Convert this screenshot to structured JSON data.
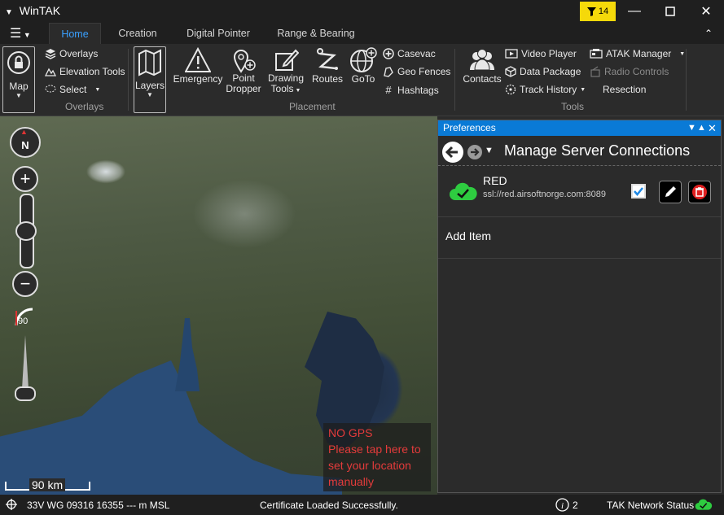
{
  "titlebar": {
    "app_title": "WinTAK",
    "filter_count": "14"
  },
  "tabs": [
    {
      "label": "Home"
    },
    {
      "label": "Creation"
    },
    {
      "label": "Digital Pointer"
    },
    {
      "label": "Range & Bearing"
    }
  ],
  "ribbon": {
    "map_label": "Map",
    "overlays_items": {
      "overlays": "Overlays",
      "elevation": "Elevation Tools",
      "select": "Select"
    },
    "overlays_group": "Overlays",
    "layers_label": "Layers",
    "emergency": "Emergency",
    "point_dropper": "Point\nDropper",
    "drawing_tools": "Drawing\nTools",
    "routes": "Routes",
    "goto": "GoTo",
    "casevac": "Casevac",
    "geo_fences": "Geo Fences",
    "hashtags": "Hashtags",
    "placement_group": "Placement",
    "contacts": "Contacts",
    "video_player": "Video Player",
    "data_package": "Data Package",
    "track_history": "Track History",
    "atak_manager": "ATAK Manager",
    "radio_controls": "Radio Controls",
    "resection": "Resection",
    "tools_group": "Tools"
  },
  "map": {
    "compass": "N",
    "tilt": "90",
    "scale": "90 km",
    "no_gps": [
      "NO GPS",
      "Please tap here to",
      "set your location",
      "manually"
    ]
  },
  "preferences": {
    "panel_title": "Preferences",
    "page_title": "Manage Server Connections",
    "servers": [
      {
        "name": "RED",
        "address": "ssl://red.airsoftnorge.com:8089",
        "enabled": true,
        "status_color": "#2ecc40"
      }
    ],
    "add_item": "Add Item"
  },
  "status": {
    "coords": "33V  WG  09316  16355  --- m MSL",
    "message": "Certificate Loaded Successfully.",
    "info_count": "2",
    "network": "TAK Network Status"
  },
  "colors": {
    "accent": "#0a7ad6",
    "tab_active": "#3aa0ff",
    "warning": "#e43b3b",
    "filter": "#f5d90a"
  }
}
